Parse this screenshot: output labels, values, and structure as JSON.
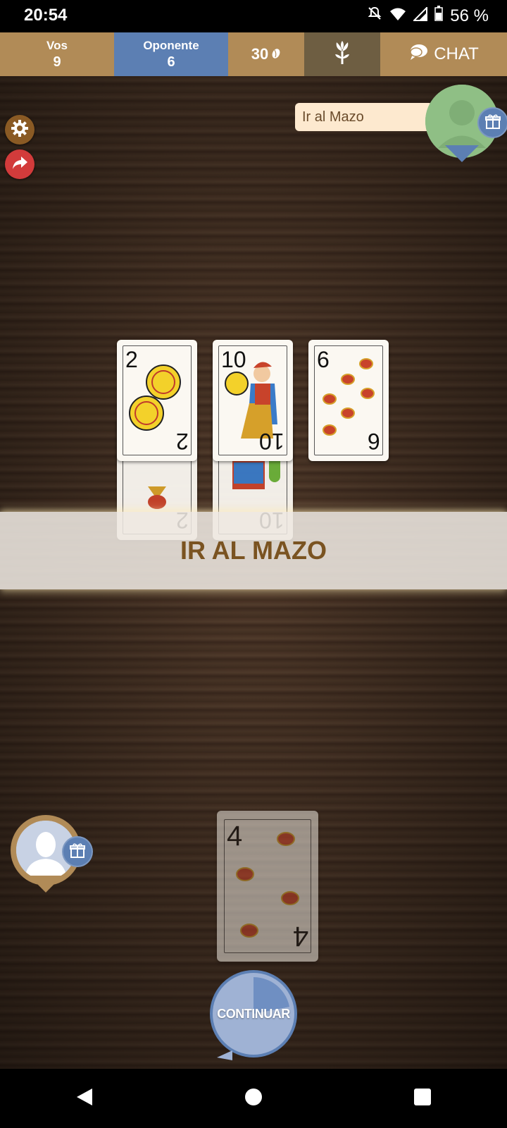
{
  "status_bar": {
    "time": "20:54",
    "battery": "56 %",
    "icons": [
      "bell-off-icon",
      "wifi-icon",
      "signal-icon",
      "battery-icon"
    ]
  },
  "scoreboard": {
    "me_label": "Vos",
    "me_score": "9",
    "opponent_label": "Oponente",
    "opponent_score": "6",
    "target_points": "30",
    "flor_icon": "flower-icon",
    "chat_label": "CHAT"
  },
  "opponent": {
    "speech": "Ir al Mazo"
  },
  "table_cards": {
    "opponent_played": [
      {
        "number": "2",
        "suit": "oros"
      },
      {
        "number": "10",
        "suit": "oros"
      },
      {
        "number": "6",
        "suit": "copas"
      }
    ],
    "my_played": [
      {
        "number": "2",
        "suit": "copas"
      },
      {
        "number": "10",
        "suit": "bastos"
      }
    ]
  },
  "banner": {
    "text": "IR AL MAZO"
  },
  "hand": [
    {
      "number": "4",
      "suit": "copas"
    }
  ],
  "continue_button": {
    "label": "CONTINUAR",
    "timer_progress": 0.22
  },
  "colors": {
    "accent_brown": "#b18b57",
    "accent_blue": "#5c7fb3",
    "banner_text": "#7a5321"
  }
}
